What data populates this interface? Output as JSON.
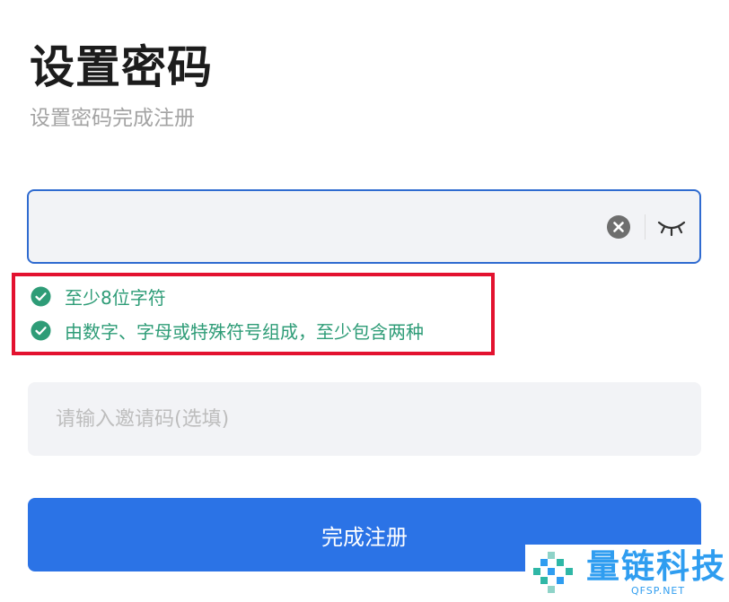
{
  "header": {
    "title": "设置密码",
    "subtitle": "设置密码完成注册"
  },
  "password": {
    "value": "",
    "clear_icon": "clear-circle-icon",
    "visibility_icon": "eye-closed-icon"
  },
  "rules": [
    {
      "text": "至少8位字符",
      "status": "passed",
      "icon": "check-circle-icon"
    },
    {
      "text": "由数字、字母或特殊符号组成，至少包含两种",
      "status": "passed",
      "icon": "check-circle-icon"
    }
  ],
  "invite": {
    "value": "",
    "placeholder": "请输入邀请码(选填)"
  },
  "submit": {
    "label": "完成注册"
  },
  "watermark": {
    "name": "量链科技",
    "domain": "QFSP.NET"
  },
  "colors": {
    "primary": "#2b73e6",
    "success": "#2e9c77",
    "highlight_border": "#e3122f",
    "field_bg": "#f2f3f6"
  }
}
